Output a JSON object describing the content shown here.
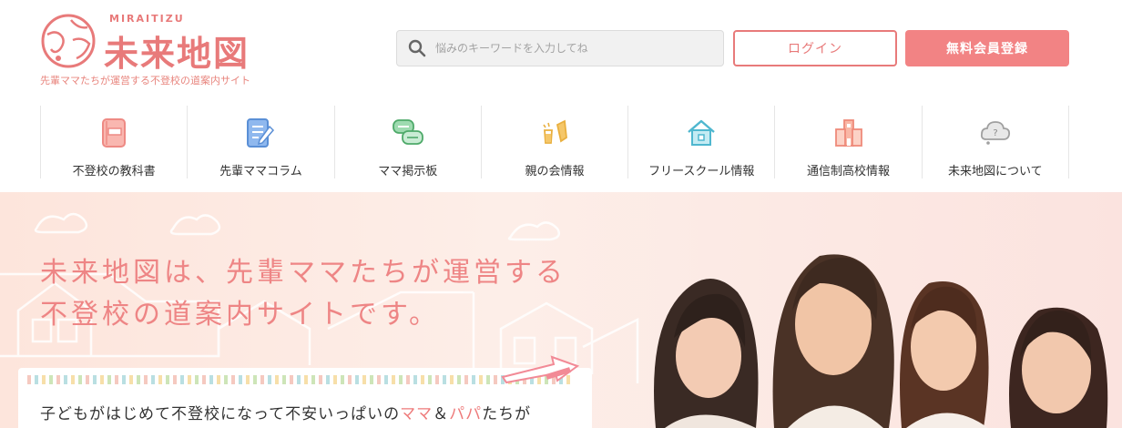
{
  "brand": {
    "sub": "MIRAITIZU",
    "name": "未来地図",
    "tagline": "先輩ママたちが運営する不登校の道案内サイト",
    "color": "#e87a7a"
  },
  "search": {
    "placeholder": "悩みのキーワードを入力してね",
    "icon": "search-icon"
  },
  "header": {
    "login_label": "ログイン",
    "register_label": "無料会員登録"
  },
  "nav": [
    {
      "label": "不登校の教科書",
      "icon": "book-icon"
    },
    {
      "label": "先輩ママコラム",
      "icon": "notepad-icon"
    },
    {
      "label": "ママ掲示板",
      "icon": "chat-bubbles-icon"
    },
    {
      "label": "親の会情報",
      "icon": "toast-icon"
    },
    {
      "label": "フリースクール情報",
      "icon": "house-icon"
    },
    {
      "label": "通信制高校情報",
      "icon": "school-building-icon"
    },
    {
      "label": "未来地図について",
      "icon": "question-cloud-icon"
    }
  ],
  "hero": {
    "title_line1": "未来地図は、先輩ママたちが運営する",
    "title_line2": "不登校の道案内サイトです。",
    "text_before": "子どもがはじめて不登校になって不安いっぱいの",
    "text_mama": "ママ",
    "text_and": "＆",
    "text_papa": "パパ",
    "text_after": "たちが"
  }
}
